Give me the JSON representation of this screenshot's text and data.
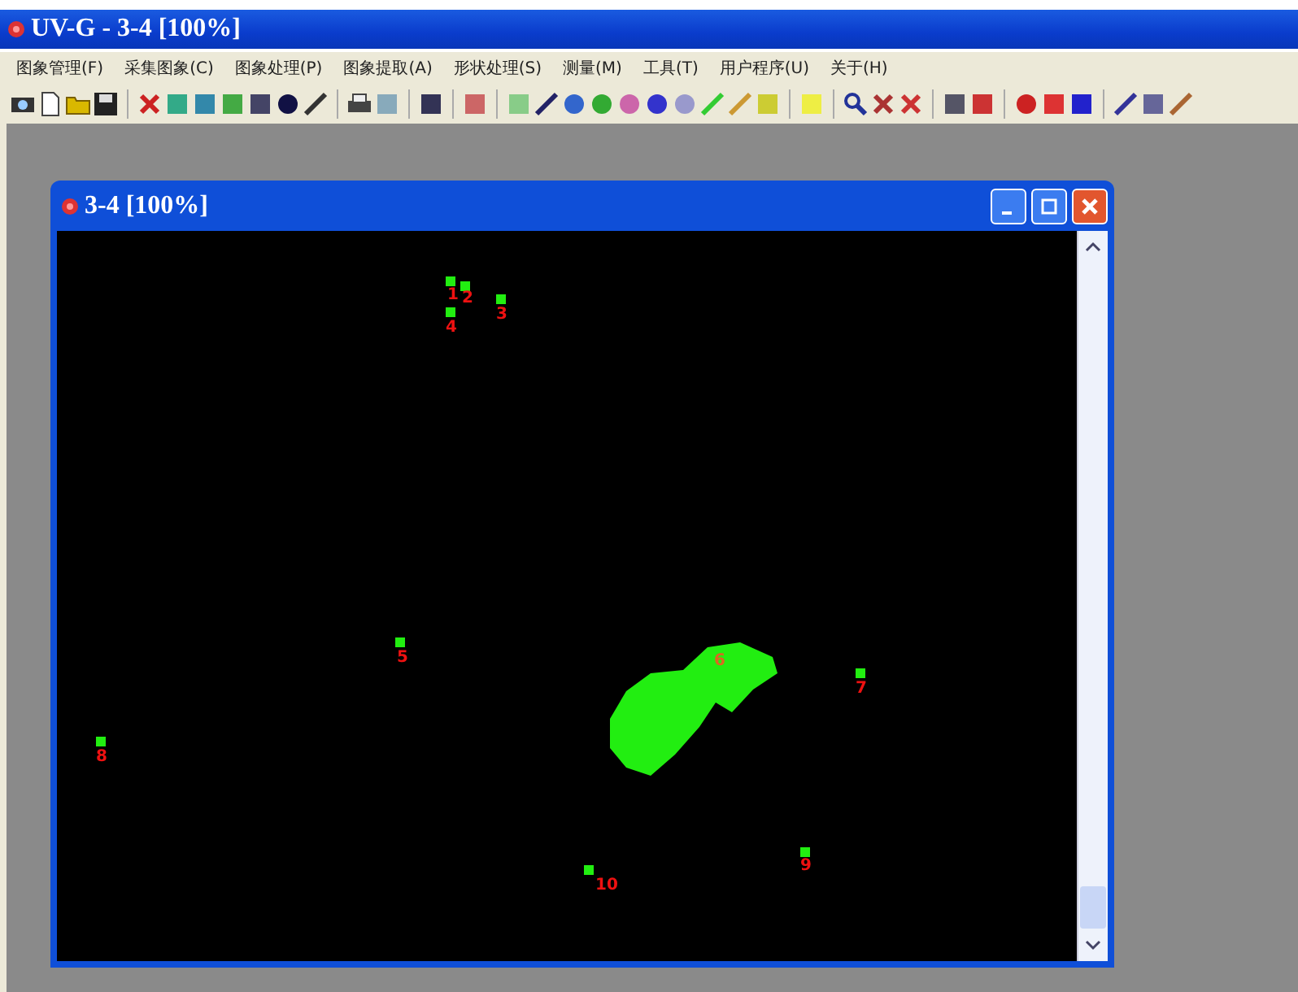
{
  "window": {
    "title": "UV-G - 3-4 [100%]"
  },
  "menu": [
    "图象管理(F)",
    "采集图象(C)",
    "图象处理(P)",
    "图象提取(A)",
    "形状处理(S)",
    "测量(M)",
    "工具(T)",
    "用户程序(U)",
    "关于(H)"
  ],
  "child_window": {
    "title": "3-4 [100%]"
  },
  "objects": [
    {
      "label": "1"
    },
    {
      "label": "2"
    },
    {
      "label": "3"
    },
    {
      "label": "4"
    },
    {
      "label": "5"
    },
    {
      "label": "6"
    },
    {
      "label": "7"
    },
    {
      "label": "8"
    },
    {
      "label": "9"
    },
    {
      "label": "10"
    }
  ]
}
